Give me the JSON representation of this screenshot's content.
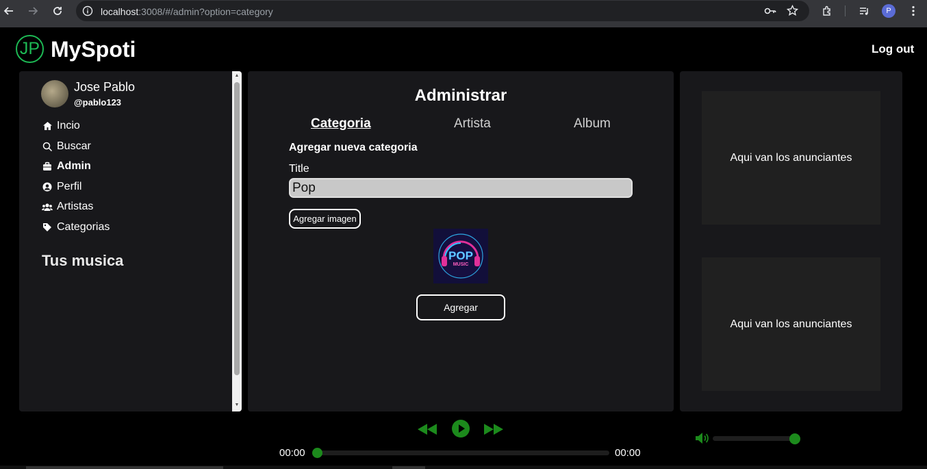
{
  "browser": {
    "url_host": "localhost",
    "url_rest": ":3008/#/admin?option=category",
    "profile_initial": "P"
  },
  "header": {
    "logo_text": "JP",
    "app_title": "MySpoti",
    "logout_label": "Log out"
  },
  "sidebar": {
    "user_name": "Jose Pablo",
    "user_handle": "@pablo123",
    "items": [
      {
        "label": "Incio",
        "icon": "home-icon"
      },
      {
        "label": "Buscar",
        "icon": "search-icon"
      },
      {
        "label": "Admin",
        "icon": "admin-icon",
        "active": true
      },
      {
        "label": "Perfil",
        "icon": "user-icon"
      },
      {
        "label": "Artistas",
        "icon": "users-icon"
      },
      {
        "label": "Categorias",
        "icon": "tag-icon"
      }
    ],
    "section_title": "Tus musica"
  },
  "main": {
    "title": "Administrar",
    "tabs": [
      {
        "label": "Categoria",
        "active": true
      },
      {
        "label": "Artista",
        "active": false
      },
      {
        "label": "Album",
        "active": false
      }
    ],
    "form_heading": "Agregar nueva categoria",
    "title_label": "Title",
    "title_value": "Pop",
    "add_image_label": "Agregar imagen",
    "preview_text_top": "POP",
    "preview_text_bottom": "MUSIC",
    "submit_label": "Agregar"
  },
  "ads": {
    "ad1": "Aqui van los anunciantes",
    "ad2": "Aqui van los anunciantes"
  },
  "player": {
    "current_time": "00:00",
    "total_time": "00:00",
    "progress": 0,
    "volume": 1.0
  },
  "colors": {
    "accent": "#1db954",
    "player_green": "#1c8a1c",
    "panel": "#18181b"
  }
}
